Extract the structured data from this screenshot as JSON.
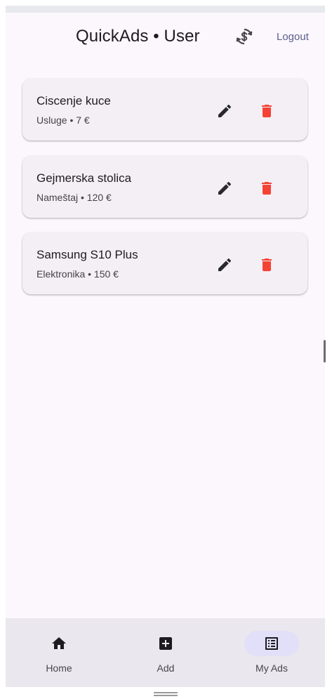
{
  "app_bar": {
    "title": "QuickAds • User",
    "sync_icon": "currency-sync-icon",
    "logout_label": "Logout"
  },
  "ads": [
    {
      "title": "Ciscenje kuce",
      "subtitle": "Usluge • 7 €"
    },
    {
      "title": "Gejmerska stolica",
      "subtitle": "Nameštaj • 120 €"
    },
    {
      "title": "Samsung S10 Plus",
      "subtitle": "Elektronika • 150 €"
    }
  ],
  "ad_actions": {
    "edit_icon": "pencil-icon",
    "delete_icon": "trash-icon"
  },
  "nav": {
    "items": [
      {
        "label": "Home",
        "icon": "home-icon"
      },
      {
        "label": "Add",
        "icon": "add-box-icon"
      },
      {
        "label": "My Ads",
        "icon": "list-alt-icon"
      }
    ],
    "active": "My Ads"
  },
  "colors": {
    "background": "#fbf7fd",
    "card": "#f3eff5",
    "delete": "#f44336",
    "edit": "#2b2930",
    "accent_link": "#5b5f8d",
    "nav_active_indicator": "#e2e0f9"
  }
}
